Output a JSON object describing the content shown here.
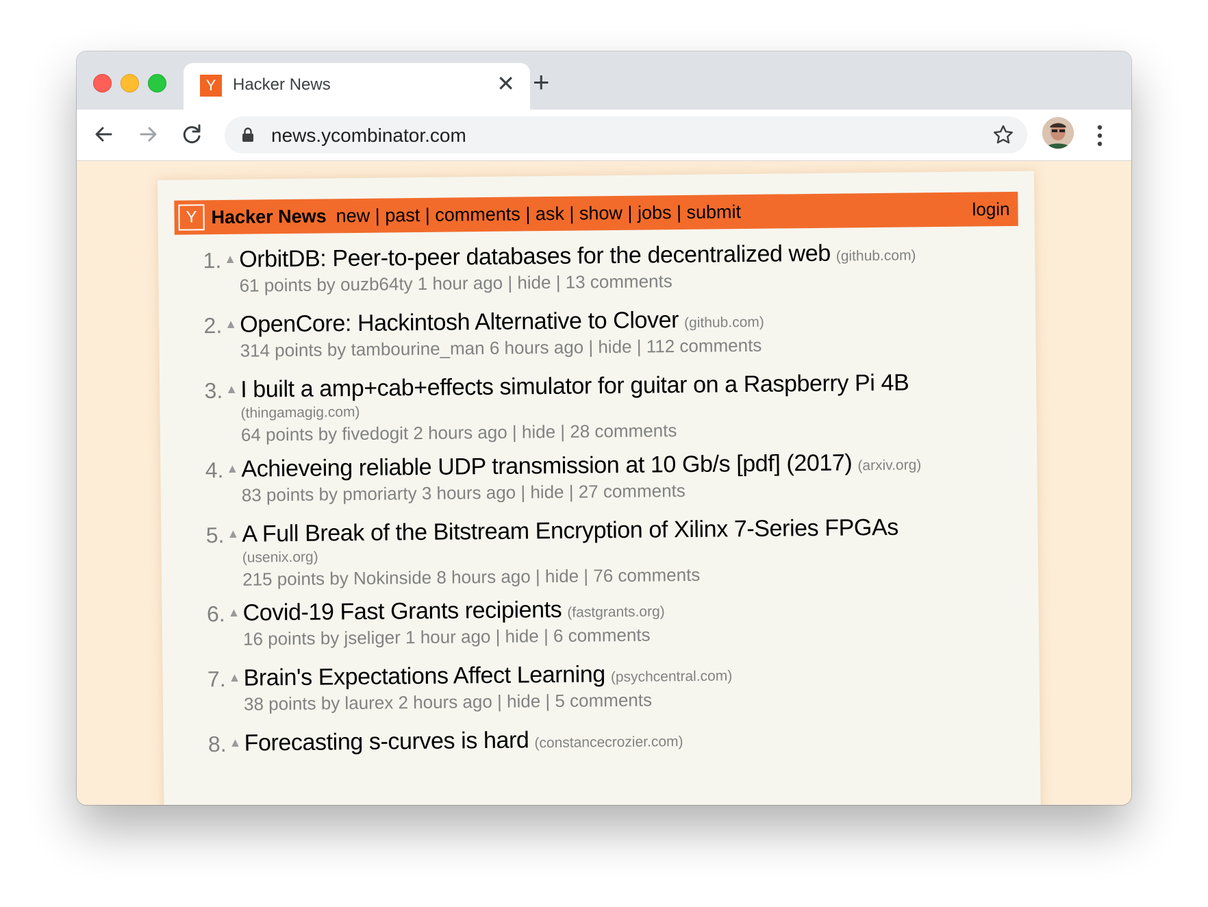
{
  "browser": {
    "tab_title": "Hacker News",
    "tab_favicon": "Y",
    "close_icon": "✕",
    "new_tab_icon": "+",
    "url": "news.ycombinator.com"
  },
  "hn": {
    "logo": "Y",
    "site_name": "Hacker News",
    "nav": [
      "new",
      "past",
      "comments",
      "ask",
      "show",
      "jobs",
      "submit"
    ],
    "login": "login",
    "colors": {
      "header": "#f26b2b",
      "page": "#f6f6ef",
      "subtext": "#828282"
    }
  },
  "stories": [
    {
      "rank": "1.",
      "title": "OrbitDB: Peer-to-peer databases for the decentralized web",
      "site": "(github.com)",
      "points": "61 points",
      "user": "ouzb64ty",
      "age": "1 hour ago",
      "hide": "hide",
      "comments": "13 comments"
    },
    {
      "rank": "2.",
      "title": "OpenCore: Hackintosh Alternative to Clover",
      "site": "(github.com)",
      "points": "314 points",
      "user": "tambourine_man",
      "age": "6 hours ago",
      "hide": "hide",
      "comments": "112 comments"
    },
    {
      "rank": "3.",
      "title": "I built a amp+cab+effects simulator for guitar on a Raspberry Pi 4B",
      "site": "(thingamagig.com)",
      "points": "64 points",
      "user": "fivedogit",
      "age": "2 hours ago",
      "hide": "hide",
      "comments": "28 comments"
    },
    {
      "rank": "4.",
      "title": "Achieveing reliable UDP transmission at 10 Gb/s [pdf] (2017)",
      "site": "(arxiv.org)",
      "points": "83 points",
      "user": "pmoriarty",
      "age": "3 hours ago",
      "hide": "hide",
      "comments": "27 comments"
    },
    {
      "rank": "5.",
      "title": "A Full Break of the Bitstream Encryption of Xilinx 7-Series FPGAs",
      "site": "(usenix.org)",
      "points": "215 points",
      "user": "Nokinside",
      "age": "8 hours ago",
      "hide": "hide",
      "comments": "76 comments"
    },
    {
      "rank": "6.",
      "title": "Covid-19 Fast Grants recipients",
      "site": "(fastgrants.org)",
      "points": "16 points",
      "user": "jseliger",
      "age": "1 hour ago",
      "hide": "hide",
      "comments": "6 comments"
    },
    {
      "rank": "7.",
      "title": "Brain's Expectations Affect Learning",
      "site": "(psychcentral.com)",
      "points": "38 points",
      "user": "laurex",
      "age": "2 hours ago",
      "hide": "hide",
      "comments": "5 comments"
    },
    {
      "rank": "8.",
      "title": "Forecasting s-curves is hard",
      "site": "(constancecrozier.com)",
      "points": "",
      "user": "",
      "age": "",
      "hide": "",
      "comments": ""
    }
  ]
}
